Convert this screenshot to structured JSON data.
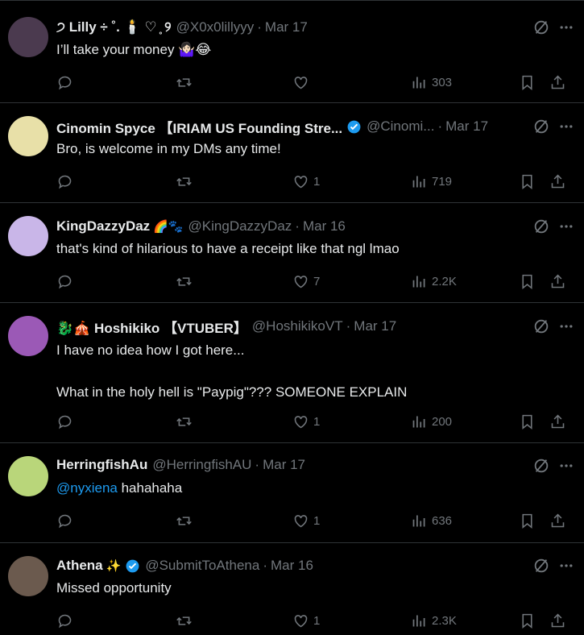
{
  "tweets": [
    {
      "name": "੭ Lilly ÷ ˚. 🕯️ ♡ ̥ ୨",
      "name_emoji": "",
      "verified": false,
      "handle": "@X0x0lillyyy",
      "date": "Mar 17",
      "text": "I’ll take your money 🤷🏻‍♀️😂",
      "mention": "",
      "replies": "",
      "retweets": "",
      "likes": "",
      "views": "303",
      "avatar_color": "#4b3a4f"
    },
    {
      "name": "Cinomin Spyce 【IRIAM US Founding Stre...",
      "name_emoji": "",
      "verified": true,
      "handle": "@Cinomi...",
      "date": "Mar 17",
      "text": "Bro, is welcome in my DMs any time!",
      "mention": "",
      "replies": "",
      "retweets": "",
      "likes": "1",
      "views": "719",
      "avatar_color": "#e8e0a8"
    },
    {
      "name": "KingDazzyDaz",
      "name_emoji": "🌈🐾",
      "verified": false,
      "handle": "@KingDazzyDaz",
      "date": "Mar 16",
      "text": "that's kind of hilarious to have a receipt like that ngl lmao",
      "mention": "",
      "replies": "",
      "retweets": "",
      "likes": "7",
      "views": "2.2K",
      "avatar_color": "#c9b6e8"
    },
    {
      "name": "🐉🎪 Hoshikiko 【VTUBER】",
      "name_emoji": "",
      "verified": false,
      "handle": "@HoshikikoVT",
      "date": "Mar 17",
      "text": "I have no idea how I got here...\n\nWhat in the holy hell is \"Paypig\"??? SOMEONE EXPLAIN",
      "mention": "",
      "replies": "",
      "retweets": "",
      "likes": "1",
      "views": "200",
      "avatar_color": "#9b59b6"
    },
    {
      "name": "HerringfishAu",
      "name_emoji": "",
      "verified": false,
      "handle": "@HerringfishAU",
      "date": "Mar 17",
      "text": " hahahaha",
      "mention": "@nyxiena",
      "replies": "",
      "retweets": "",
      "likes": "1",
      "views": "636",
      "avatar_color": "#b9d67a"
    },
    {
      "name": "Athena",
      "name_emoji": "✨",
      "verified": true,
      "handle": "@SubmitToAthena",
      "date": "Mar 16",
      "text": "Missed opportunity",
      "mention": "",
      "replies": "",
      "retweets": "",
      "likes": "1",
      "views": "2.3K",
      "avatar_color": "#6b5a4e"
    }
  ],
  "icons": {
    "reply": "reply-icon",
    "retweet": "retweet-icon",
    "like": "heart-icon",
    "views": "views-icon",
    "bookmark": "bookmark-icon",
    "share": "share-icon",
    "grok": "grok-icon",
    "more": "more-icon"
  },
  "colors": {
    "background": "#000000",
    "text": "#e7e9ea",
    "muted": "#71767b",
    "link": "#1d9bf0",
    "verified": "#1d9bf0",
    "divider": "#2f3336"
  }
}
